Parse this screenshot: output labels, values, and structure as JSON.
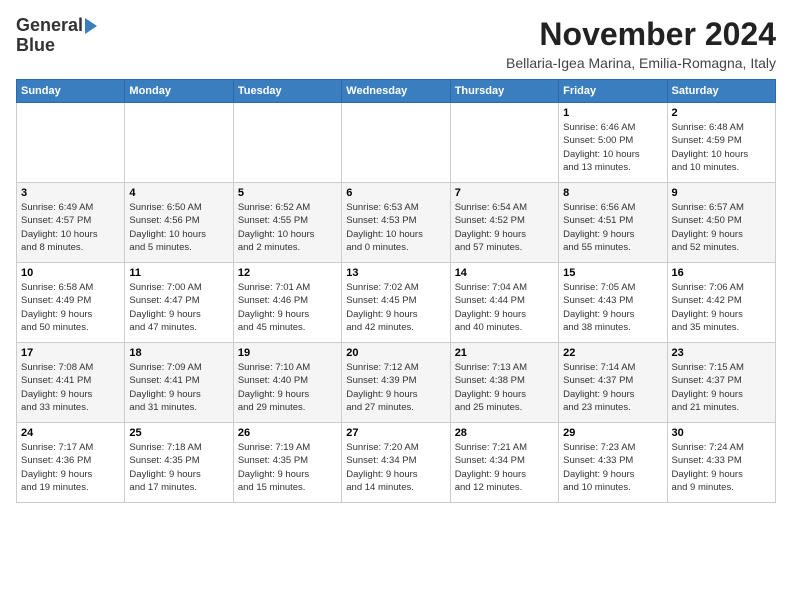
{
  "header": {
    "logo_line1": "General",
    "logo_line2": "Blue",
    "month_title": "November 2024",
    "location": "Bellaria-Igea Marina, Emilia-Romagna, Italy"
  },
  "weekdays": [
    "Sunday",
    "Monday",
    "Tuesday",
    "Wednesday",
    "Thursday",
    "Friday",
    "Saturday"
  ],
  "weeks": [
    [
      {
        "day": "",
        "info": ""
      },
      {
        "day": "",
        "info": ""
      },
      {
        "day": "",
        "info": ""
      },
      {
        "day": "",
        "info": ""
      },
      {
        "day": "",
        "info": ""
      },
      {
        "day": "1",
        "info": "Sunrise: 6:46 AM\nSunset: 5:00 PM\nDaylight: 10 hours\nand 13 minutes."
      },
      {
        "day": "2",
        "info": "Sunrise: 6:48 AM\nSunset: 4:59 PM\nDaylight: 10 hours\nand 10 minutes."
      }
    ],
    [
      {
        "day": "3",
        "info": "Sunrise: 6:49 AM\nSunset: 4:57 PM\nDaylight: 10 hours\nand 8 minutes."
      },
      {
        "day": "4",
        "info": "Sunrise: 6:50 AM\nSunset: 4:56 PM\nDaylight: 10 hours\nand 5 minutes."
      },
      {
        "day": "5",
        "info": "Sunrise: 6:52 AM\nSunset: 4:55 PM\nDaylight: 10 hours\nand 2 minutes."
      },
      {
        "day": "6",
        "info": "Sunrise: 6:53 AM\nSunset: 4:53 PM\nDaylight: 10 hours\nand 0 minutes."
      },
      {
        "day": "7",
        "info": "Sunrise: 6:54 AM\nSunset: 4:52 PM\nDaylight: 9 hours\nand 57 minutes."
      },
      {
        "day": "8",
        "info": "Sunrise: 6:56 AM\nSunset: 4:51 PM\nDaylight: 9 hours\nand 55 minutes."
      },
      {
        "day": "9",
        "info": "Sunrise: 6:57 AM\nSunset: 4:50 PM\nDaylight: 9 hours\nand 52 minutes."
      }
    ],
    [
      {
        "day": "10",
        "info": "Sunrise: 6:58 AM\nSunset: 4:49 PM\nDaylight: 9 hours\nand 50 minutes."
      },
      {
        "day": "11",
        "info": "Sunrise: 7:00 AM\nSunset: 4:47 PM\nDaylight: 9 hours\nand 47 minutes."
      },
      {
        "day": "12",
        "info": "Sunrise: 7:01 AM\nSunset: 4:46 PM\nDaylight: 9 hours\nand 45 minutes."
      },
      {
        "day": "13",
        "info": "Sunrise: 7:02 AM\nSunset: 4:45 PM\nDaylight: 9 hours\nand 42 minutes."
      },
      {
        "day": "14",
        "info": "Sunrise: 7:04 AM\nSunset: 4:44 PM\nDaylight: 9 hours\nand 40 minutes."
      },
      {
        "day": "15",
        "info": "Sunrise: 7:05 AM\nSunset: 4:43 PM\nDaylight: 9 hours\nand 38 minutes."
      },
      {
        "day": "16",
        "info": "Sunrise: 7:06 AM\nSunset: 4:42 PM\nDaylight: 9 hours\nand 35 minutes."
      }
    ],
    [
      {
        "day": "17",
        "info": "Sunrise: 7:08 AM\nSunset: 4:41 PM\nDaylight: 9 hours\nand 33 minutes."
      },
      {
        "day": "18",
        "info": "Sunrise: 7:09 AM\nSunset: 4:41 PM\nDaylight: 9 hours\nand 31 minutes."
      },
      {
        "day": "19",
        "info": "Sunrise: 7:10 AM\nSunset: 4:40 PM\nDaylight: 9 hours\nand 29 minutes."
      },
      {
        "day": "20",
        "info": "Sunrise: 7:12 AM\nSunset: 4:39 PM\nDaylight: 9 hours\nand 27 minutes."
      },
      {
        "day": "21",
        "info": "Sunrise: 7:13 AM\nSunset: 4:38 PM\nDaylight: 9 hours\nand 25 minutes."
      },
      {
        "day": "22",
        "info": "Sunrise: 7:14 AM\nSunset: 4:37 PM\nDaylight: 9 hours\nand 23 minutes."
      },
      {
        "day": "23",
        "info": "Sunrise: 7:15 AM\nSunset: 4:37 PM\nDaylight: 9 hours\nand 21 minutes."
      }
    ],
    [
      {
        "day": "24",
        "info": "Sunrise: 7:17 AM\nSunset: 4:36 PM\nDaylight: 9 hours\nand 19 minutes."
      },
      {
        "day": "25",
        "info": "Sunrise: 7:18 AM\nSunset: 4:35 PM\nDaylight: 9 hours\nand 17 minutes."
      },
      {
        "day": "26",
        "info": "Sunrise: 7:19 AM\nSunset: 4:35 PM\nDaylight: 9 hours\nand 15 minutes."
      },
      {
        "day": "27",
        "info": "Sunrise: 7:20 AM\nSunset: 4:34 PM\nDaylight: 9 hours\nand 14 minutes."
      },
      {
        "day": "28",
        "info": "Sunrise: 7:21 AM\nSunset: 4:34 PM\nDaylight: 9 hours\nand 12 minutes."
      },
      {
        "day": "29",
        "info": "Sunrise: 7:23 AM\nSunset: 4:33 PM\nDaylight: 9 hours\nand 10 minutes."
      },
      {
        "day": "30",
        "info": "Sunrise: 7:24 AM\nSunset: 4:33 PM\nDaylight: 9 hours\nand 9 minutes."
      }
    ]
  ]
}
